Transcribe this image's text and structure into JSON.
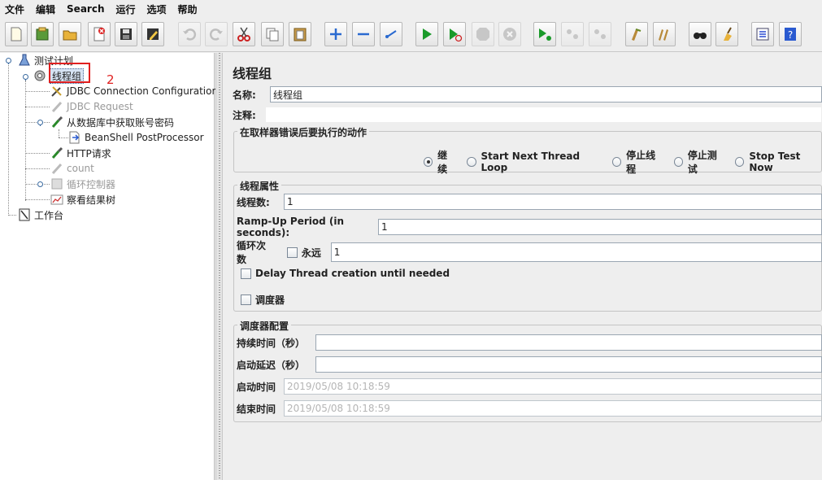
{
  "menu": [
    "文件",
    "编辑",
    "Search",
    "运行",
    "选项",
    "帮助"
  ],
  "toolbar": {
    "buttons": [
      "new-icon",
      "templates-icon",
      "open-icon",
      "close-icon",
      "save-icon",
      "save-as-icon",
      "undo-icon",
      "redo-icon",
      "cut-icon",
      "copy-icon",
      "paste-icon",
      "expand-icon",
      "collapse-icon",
      "toggle-icon",
      "start-icon",
      "start-no-pause-icon",
      "stop-icon",
      "shutdown-icon",
      "remote-start-icon",
      "remote-stop-icon",
      "remote-shutdown-icon",
      "clear-icon",
      "clear-all-icon",
      "search-icon",
      "reset-search-icon",
      "function-helper-icon",
      "help-icon"
    ]
  },
  "tree": {
    "test_plan": "测试计划",
    "thread_group": "线程组",
    "annotation": "2",
    "jdbc_config": "JDBC Connection Configuration",
    "jdbc_request": "JDBC Request",
    "db_fetch": "从数据库中获取账号密码",
    "beanshell": "BeanShell PostProcessor",
    "http": "HTTP请求",
    "count": "count",
    "loop": "循环控制器",
    "results_tree": "察看结果树",
    "workbench": "工作台"
  },
  "panel": {
    "title": "线程组",
    "name_label": "名称:",
    "name_value": "线程组",
    "comment_label": "注释:",
    "comment_value": "",
    "error_group_title": "在取样器错误后要执行的动作",
    "error_actions": [
      "继续",
      "Start Next Thread Loop",
      "停止线程",
      "停止测试",
      "Stop Test Now"
    ],
    "error_selected": "继续",
    "thread_group_title": "线程属性",
    "threads_label": "线程数:",
    "threads_value": "1",
    "rampup_label": "Ramp-Up Period (in seconds):",
    "rampup_value": "1",
    "loop_label": "循环次数",
    "forever_label": "永远",
    "loop_value": "1",
    "delay_label": "Delay Thread creation until needed",
    "scheduler_label": "调度器",
    "scheduler_group_title": "调度器配置",
    "duration_label": "持续时间（秒）",
    "duration_value": "",
    "startup_delay_label": "启动延迟（秒）",
    "startup_delay_value": "",
    "start_time_label": "启动时间",
    "start_time_value": "2019/05/08 10:18:59",
    "end_time_label": "结束时间",
    "end_time_value": "2019/05/08 10:18:59"
  },
  "colors": {
    "highlight_box": "#e02020",
    "selection": "#d6e3f3"
  }
}
